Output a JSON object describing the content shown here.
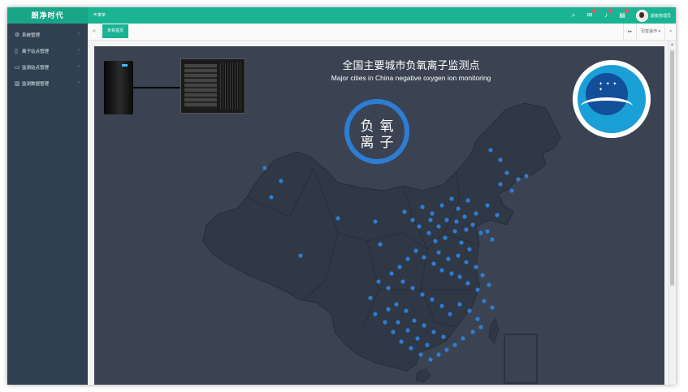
{
  "app": {
    "brand": "朗净时代"
  },
  "header": {
    "menu_toggle_label": "菜单",
    "icons": [
      "search-icon",
      "mail-icon",
      "bell-icon",
      "chart-icon"
    ],
    "badge_color": "#ed5565",
    "username": "超级管理员"
  },
  "sidebar": {
    "items": [
      {
        "label": "系统管理",
        "icon": "gear-icon"
      },
      {
        "label": "离子站点管理",
        "icon": "mobile-icon"
      },
      {
        "label": "监测站点管理",
        "icon": "monitor-icon"
      },
      {
        "label": "监测数据管理",
        "icon": "bar-chart-icon"
      }
    ]
  },
  "tabs": {
    "active": "负氧首页",
    "right_controls": [
      "▸▸",
      "页签操作 ▾",
      "×"
    ]
  },
  "dashboard": {
    "title_cn": "全国主要城市负氧离子监测点",
    "title_en": "Major cities in China negative oxygen ion monitoring",
    "ring_text_line1": "负氧",
    "ring_text_line2": "离子",
    "accent_color": "#2e7dd4",
    "map_fill": "#303846",
    "background": "#3b4352"
  }
}
